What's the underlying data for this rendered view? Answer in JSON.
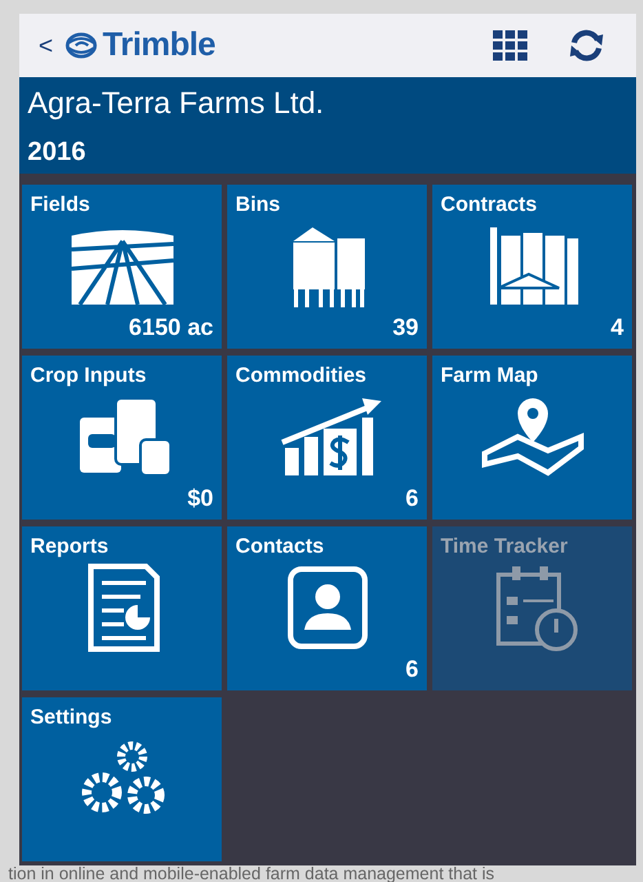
{
  "header": {
    "back": "<",
    "logo": "Trimble"
  },
  "farm": {
    "name": "Agra-Terra Farms Ltd.",
    "year": "2016"
  },
  "tiles": [
    {
      "label": "Fields",
      "kind": "fields",
      "count": "6150 ac",
      "disabled": false
    },
    {
      "label": "Bins",
      "kind": "bins",
      "count": "39",
      "disabled": false
    },
    {
      "label": "Contracts",
      "kind": "contracts",
      "count": "4",
      "disabled": false
    },
    {
      "label": "Crop Inputs",
      "kind": "inputs",
      "count": "$0",
      "disabled": false
    },
    {
      "label": "Commodities",
      "kind": "commodities",
      "count": "6",
      "disabled": false
    },
    {
      "label": "Farm Map",
      "kind": "map",
      "disabled": false
    },
    {
      "label": "Reports",
      "kind": "reports",
      "disabled": false
    },
    {
      "label": "Contacts",
      "kind": "contacts",
      "count": "6",
      "disabled": false
    },
    {
      "label": "Time Tracker",
      "kind": "time",
      "disabled": true
    },
    {
      "label": "Settings",
      "kind": "settings",
      "disabled": false
    }
  ],
  "background_text": "tion in online and mobile-enabled farm data management that is"
}
